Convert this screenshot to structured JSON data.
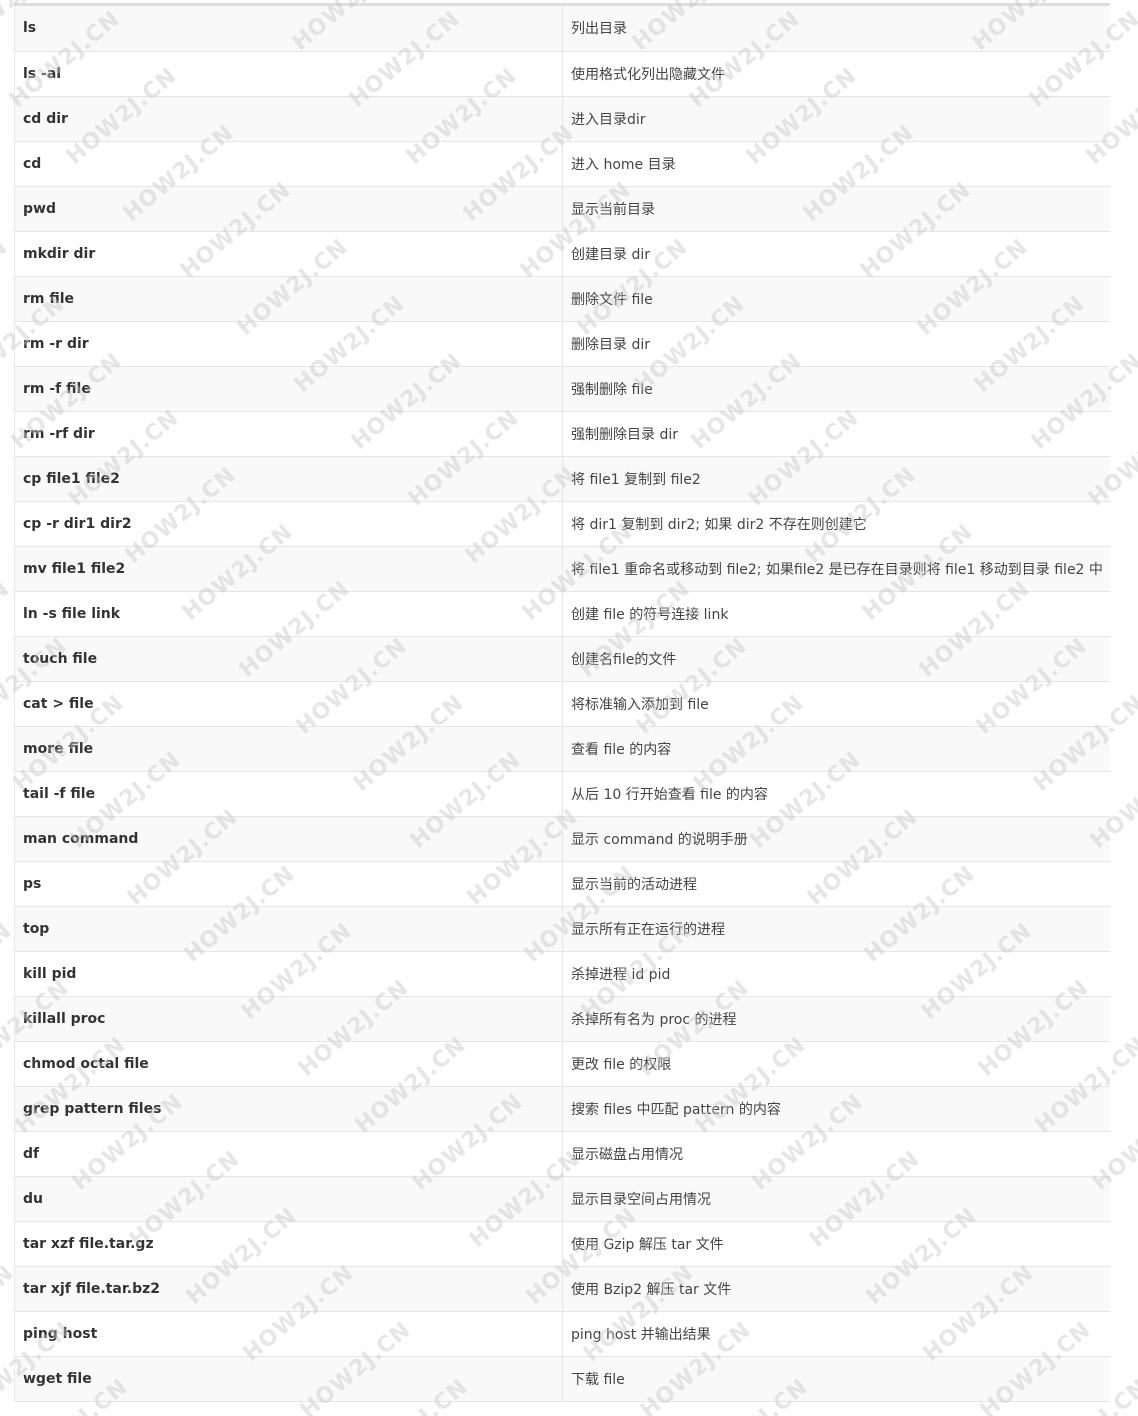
{
  "watermark": "HOW2J.CN",
  "rows": [
    {
      "cmd": "ls",
      "desc": "列出目录"
    },
    {
      "cmd": "ls -al",
      "desc": "使用格式化列出隐藏文件"
    },
    {
      "cmd": "cd dir",
      "desc": "进入目录dir"
    },
    {
      "cmd": "cd",
      "desc": "进入 home 目录"
    },
    {
      "cmd": "pwd",
      "desc": "显示当前目录"
    },
    {
      "cmd": "mkdir dir",
      "desc": "创建目录 dir"
    },
    {
      "cmd": "rm file",
      "desc": "删除文件 file"
    },
    {
      "cmd": "rm -r dir",
      "desc": "删除目录 dir"
    },
    {
      "cmd": "rm -f file",
      "desc": "强制删除 file"
    },
    {
      "cmd": "rm -rf dir",
      "desc": "强制删除目录 dir"
    },
    {
      "cmd": "cp file1 file2",
      "desc": "将 file1 复制到 file2"
    },
    {
      "cmd": "cp -r dir1 dir2",
      "desc": "将 dir1 复制到 dir2; 如果 dir2 不存在则创建它"
    },
    {
      "cmd": "mv file1 file2",
      "desc": "将 file1 重命名或移动到 file2; 如果file2 是已存在目录则将 file1 移动到目录 file2 中"
    },
    {
      "cmd": "ln -s file link",
      "desc": "创建 file 的符号连接 link"
    },
    {
      "cmd": "touch file",
      "desc": "创建名file的文件"
    },
    {
      "cmd": "cat > file",
      "desc": "将标准输入添加到 file"
    },
    {
      "cmd": "more file",
      "desc": "查看 file 的内容"
    },
    {
      "cmd": "tail -f file",
      "desc": "从后 10 行开始查看 file 的内容"
    },
    {
      "cmd": "man command",
      "desc": "显示 command 的说明手册"
    },
    {
      "cmd": "ps",
      "desc": "显示当前的活动进程"
    },
    {
      "cmd": "top",
      "desc": "显示所有正在运行的进程"
    },
    {
      "cmd": "kill pid",
      "desc": "杀掉进程 id pid"
    },
    {
      "cmd": "killall proc",
      "desc": "杀掉所有名为 proc 的进程"
    },
    {
      "cmd": "chmod octal file",
      "desc": "更改 file 的权限"
    },
    {
      "cmd": "grep pattern files",
      "desc": "搜索 files 中匹配 pattern 的内容"
    },
    {
      "cmd": "df",
      "desc": "显示磁盘占用情况"
    },
    {
      "cmd": "du",
      "desc": "显示目录空间占用情况"
    },
    {
      "cmd": "tar xzf file.tar.gz",
      "desc": "使用 Gzip 解压 tar 文件"
    },
    {
      "cmd": "tar xjf file.tar.bz2",
      "desc": "使用 Bzip2 解压 tar 文件"
    },
    {
      "cmd": "ping host",
      "desc": "ping host 并输出结果"
    },
    {
      "cmd": "wget file",
      "desc": "下载 file"
    }
  ]
}
